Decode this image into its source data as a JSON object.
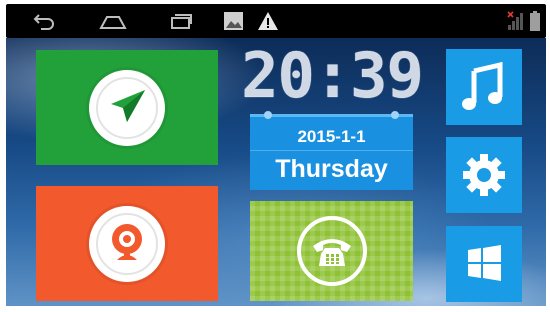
{
  "status_bar": {
    "left_icons": [
      "back-arrow-icon",
      "home-icon",
      "recent-apps-icon",
      "picture-icon",
      "warning-icon"
    ],
    "right_icons": [
      "signal-no-service-icon",
      "battery-icon"
    ]
  },
  "clock": {
    "time": "20:39"
  },
  "calendar": {
    "date": "2015-1-1",
    "weekday": "Thursday"
  },
  "tiles": [
    {
      "name": "navigation",
      "icon": "navigation-arrow-icon",
      "color": "#22a13a"
    },
    {
      "name": "camera",
      "icon": "webcam-icon",
      "color": "#f2592c"
    },
    {
      "name": "phone",
      "icon": "telephone-icon",
      "color": "#8ec234"
    },
    {
      "name": "music",
      "icon": "music-note-icon",
      "color": "#1a9be6"
    },
    {
      "name": "settings",
      "icon": "gear-icon",
      "color": "#1a9be6"
    },
    {
      "name": "windows",
      "icon": "windows-logo-icon",
      "color": "#1a9be6"
    }
  ]
}
